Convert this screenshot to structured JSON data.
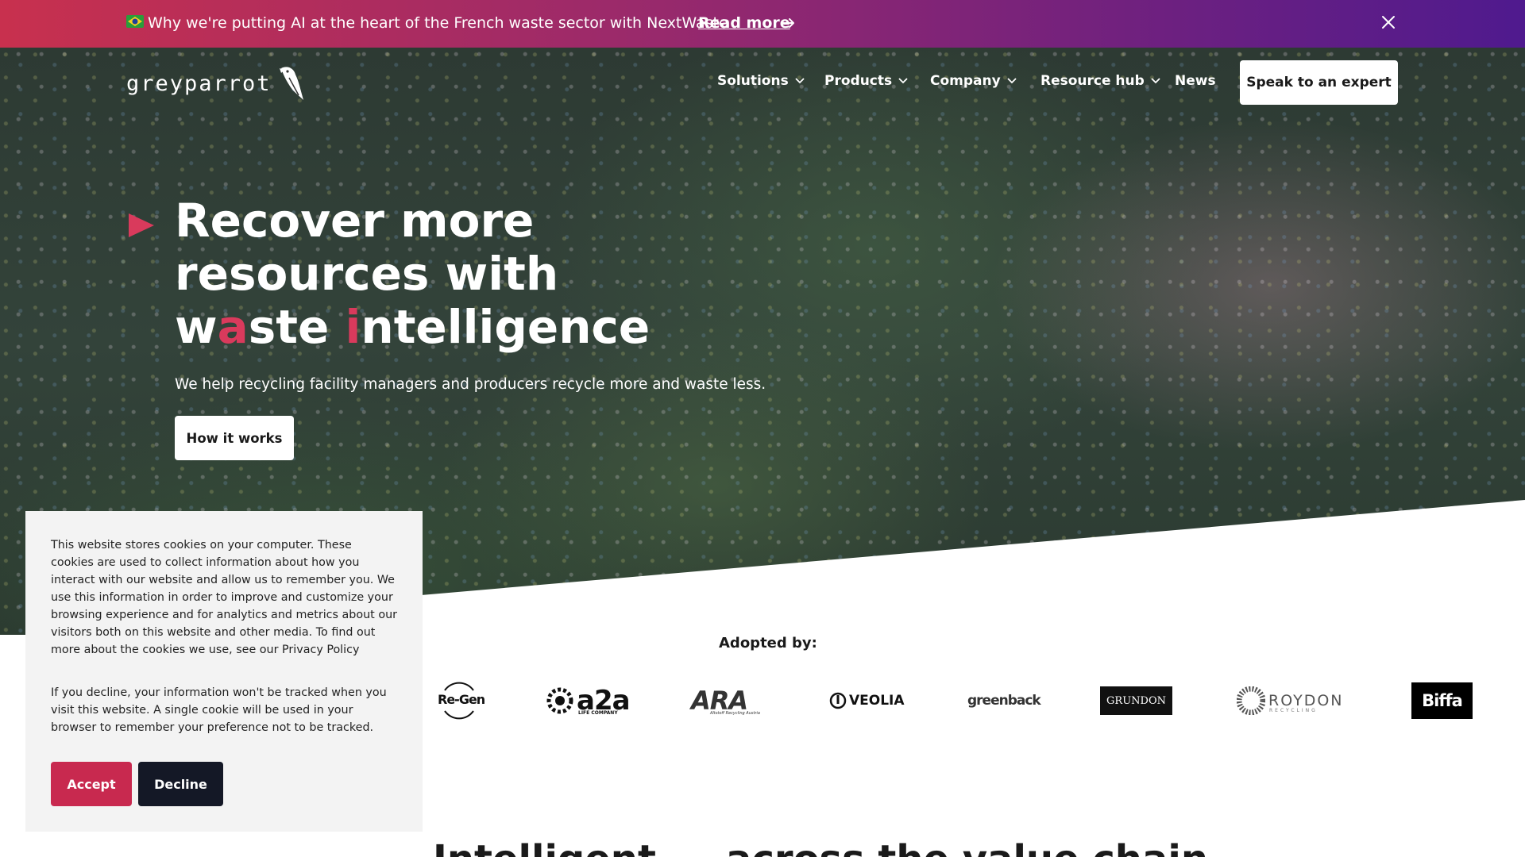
{
  "announcement": {
    "message": "Why we're putting AI at the heart of the French waste sector with NextWaste",
    "link_label": "Read more",
    "flag_icon": "brazil-flag-emoji",
    "arrow_icon": "arrow-right-icon",
    "close_icon": "close-icon"
  },
  "header": {
    "logo_text": "greyparrot",
    "nav": [
      {
        "label": "Solutions",
        "has_dropdown": true
      },
      {
        "label": "Products",
        "has_dropdown": true
      },
      {
        "label": "Company",
        "has_dropdown": true
      },
      {
        "label": "Resource hub",
        "has_dropdown": true
      },
      {
        "label": "News",
        "has_dropdown": false
      }
    ],
    "cta_label": "Speak to an expert"
  },
  "hero": {
    "headline_line1": "Recover more",
    "headline_line2": "resources with",
    "headline_w": "w",
    "headline_a": "a",
    "headline_ste": "ste ",
    "headline_i": "i",
    "headline_ntelligence": "ntelligence",
    "subheading": "We help recycling facility managers and producers recycle more and waste less.",
    "button_label": "How it works"
  },
  "adopted": {
    "label": "Adopted by:",
    "brands": [
      "Re-Gen",
      "a2a",
      "LIFE COMPANY",
      "ARA",
      "Altstoff Recycling Austria",
      "VEOLIA",
      "greenback",
      "GRUNDON",
      "ROYDON",
      "RECYCLING",
      "Biffa"
    ]
  },
  "bottom": {
    "heading_fragment": "Intelligent ... across the value chain"
  },
  "cookie": {
    "paragraph1": "This website stores cookies on your computer. These cookies are used to collect information about how you interact with our website and allow us to remember you. We use this information in order to improve and customize your browsing experience and for analytics and metrics about our visitors both on this website and other media. To find out more about the cookies we use, see our Privacy Policy",
    "paragraph2": "If you decline, your information won't be tracked when you visit this website. A single cookie will be used in your browser to remember your preference not to be tracked.",
    "accept_label": "Accept",
    "decline_label": "Decline"
  },
  "colors": {
    "accent": "#c8294f",
    "dark_button": "#141826",
    "banner_start": "#c8304e",
    "banner_end": "#4f1a8e"
  }
}
